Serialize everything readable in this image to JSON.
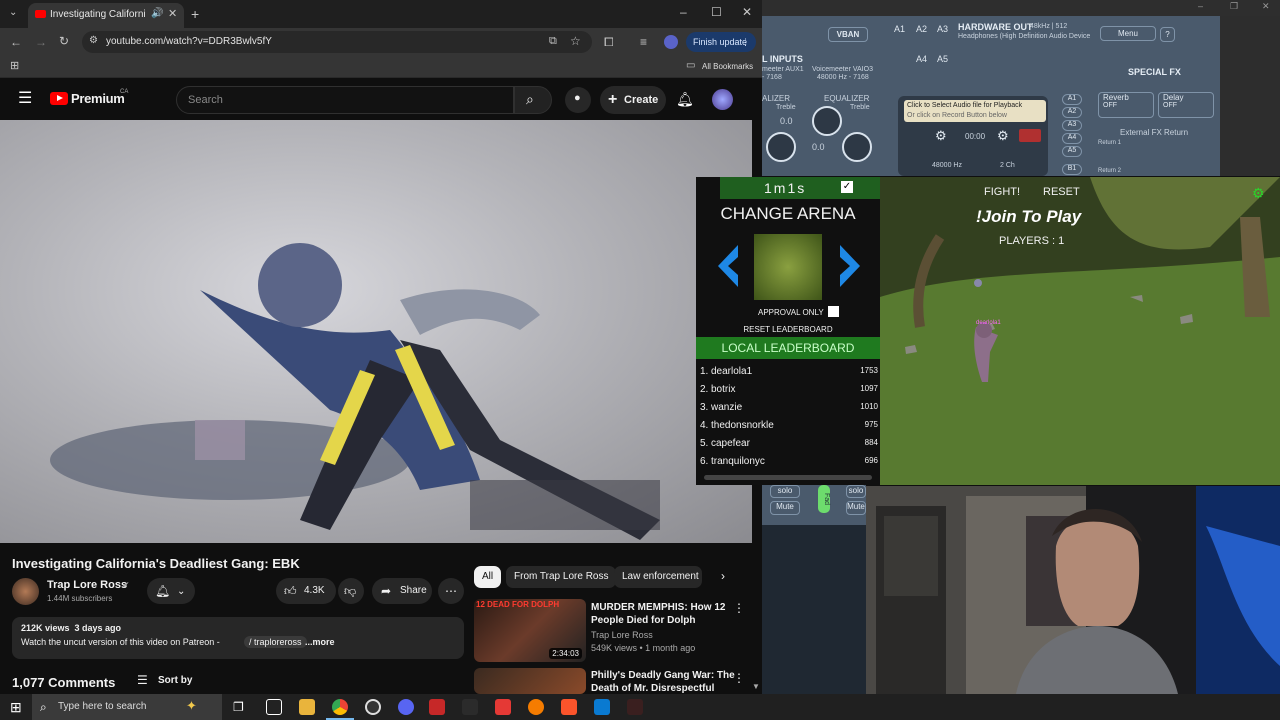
{
  "browser": {
    "tab_title": "Investigating California's De",
    "url": "youtube.com/watch?v=DDR3Bwlv5fY",
    "finish_update": "Finish update",
    "all_bookmarks": "All Bookmarks"
  },
  "youtube": {
    "logo_text": "Premium",
    "logo_region": "CA",
    "search_placeholder": "Search",
    "create_label": "Create",
    "video_title": "Investigating California's Deadliest Gang: EBK",
    "channel_name": "Trap Lore Ross",
    "subscribers": "1.44M subscribers",
    "likes": "4.3K",
    "share_label": "Share",
    "views_line": "212K views  3 days ago",
    "description": "Watch the uncut version of this video on Patreon -",
    "patreon_link": "/ traploreross",
    "more_label": "...more",
    "comments_count": "1,077 Comments",
    "sort_by": "Sort by",
    "chips": [
      "All",
      "From Trap Lore Ross",
      "Law enforcement"
    ],
    "recommendations": [
      {
        "title_line1": "MURDER MEMPHIS: How 12",
        "title_line2": "People Died for Dolph",
        "channel": "Trap Lore Ross",
        "meta": "549K views • 1 month ago",
        "duration": "2:34:03",
        "thumb_text": "12 DEAD FOR DOLPH"
      },
      {
        "title_line1": "Philly's Deadly Gang War: The",
        "title_line2": "Death of Mr. Disrespectful"
      }
    ]
  },
  "voicemeeter": {
    "vban": "VBAN",
    "bus_a": [
      "A1",
      "A2",
      "A3",
      "A4",
      "A5"
    ],
    "hardware_out": "HARDWARE OUT",
    "hardware_out_rate": "48kHz | 512",
    "hardware_device": "Headphones (High Definition Audio Device",
    "menu": "Menu",
    "inputs_label": "L INPUTS",
    "virtual_input_1": "meeter AUX1",
    "virtual_input_1_rate": "- 7168",
    "virtual_input_2": "Voicemeeter VAIO3",
    "virtual_input_2_rate": "48000 Hz - 7168",
    "equalizer_1": "ALIZER",
    "equalizer_2": "EQUALIZER",
    "treble": "Treble",
    "knob_value": "0.0",
    "player_line1": "Click to Select Audio file for Playback",
    "player_line2": "Or click on Record Button below",
    "player_time": "00:00",
    "player_rate": "48000 Hz",
    "player_channels": "2 Ch",
    "bus_b": [
      "A1",
      "A2",
      "A3",
      "A4",
      "A5",
      "B1"
    ],
    "special_fx": "SPECIAL FX",
    "reverb": "Reverb",
    "reverb_state": "OFF",
    "delay": "Delay",
    "delay_state": "OFF",
    "external_fx": "External FX Return",
    "return_1": "Return 1",
    "return_2": "Return 2",
    "solo": "solo",
    "mute": "Mute",
    "fader_label": "Fad"
  },
  "arena": {
    "timer": "1m1s",
    "change_arena": "CHANGE ARENA",
    "approval_only": "APPROVAL ONLY",
    "reset_leaderboard": "RESET LEADERBOARD",
    "local_leaderboard": "LOCAL LEADERBOARD",
    "leaderboard": [
      {
        "rank": "1.",
        "name": "dearlola1",
        "score": "1753"
      },
      {
        "rank": "2.",
        "name": "botrix",
        "score": "1097"
      },
      {
        "rank": "3.",
        "name": "wanzie",
        "score": "1010"
      },
      {
        "rank": "4.",
        "name": "thedonsnorkle",
        "score": "975"
      },
      {
        "rank": "5.",
        "name": "capefear",
        "score": "884"
      },
      {
        "rank": "6.",
        "name": "tranquilonyc",
        "score": "696"
      }
    ]
  },
  "game": {
    "fight": "FIGHT!",
    "reset": "RESET",
    "join": "!Join To Play",
    "players": "PLAYERS : 1",
    "player_tag": "dearlola1"
  },
  "taskbar": {
    "search_placeholder": "Type here to search"
  },
  "colors": {
    "youtube_red": "#ff0000",
    "leaderboard_green": "#1f7a1f",
    "arrow_blue": "#1e88e5",
    "join_text": "#ffffff",
    "voicemeeter_bg": "#4a5a6c"
  }
}
